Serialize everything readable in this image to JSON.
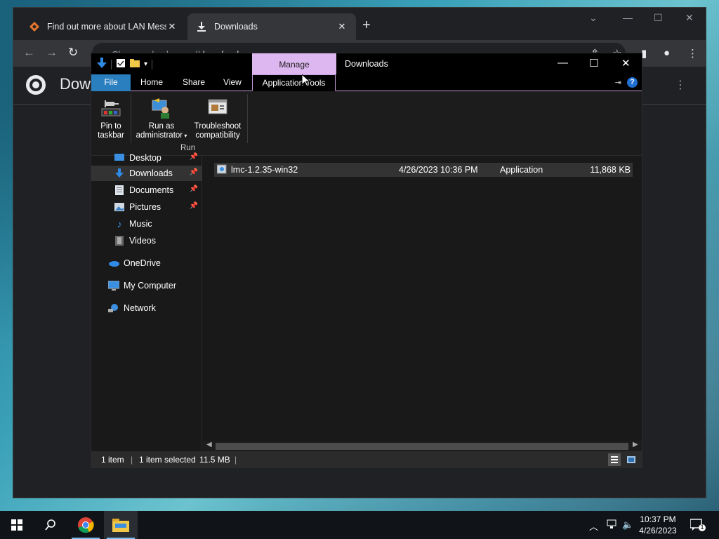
{
  "chrome": {
    "tabs": [
      {
        "label": "Find out more about LAN Messe",
        "icon": "lan-messenger-favicon"
      },
      {
        "label": "Downloads",
        "icon": "download-icon"
      }
    ],
    "address": {
      "prefix": "Chrome",
      "sep": "|",
      "url_scheme": "chrome://",
      "url_host": "downloads"
    },
    "page_title": "Dow"
  },
  "explorer": {
    "title": "Downloads",
    "contextual_tab_group": "Manage",
    "ribbon_tabs": {
      "file": "File",
      "home": "Home",
      "share": "Share",
      "view": "View",
      "app_tools": "Application Tools"
    },
    "ribbon_buttons": {
      "pin": {
        "line1": "Pin to",
        "line2": "taskbar"
      },
      "run_admin": {
        "line1": "Run as",
        "line2": "administrator"
      },
      "troubleshoot": {
        "line1": "Troubleshoot",
        "line2": "compatibility"
      }
    },
    "ribbon_group": "Run",
    "nav": [
      {
        "label": "Desktop",
        "pinned": true
      },
      {
        "label": "Downloads",
        "pinned": true,
        "selected": true
      },
      {
        "label": "Documents",
        "pinned": true
      },
      {
        "label": "Pictures",
        "pinned": true
      },
      {
        "label": "Music",
        "pinned": false
      },
      {
        "label": "Videos",
        "pinned": false
      },
      {
        "label": "OneDrive",
        "pinned": false
      },
      {
        "label": "My Computer",
        "pinned": false
      },
      {
        "label": "Network",
        "pinned": false
      }
    ],
    "files": [
      {
        "name": "lmc-1.2.35-win32",
        "date": "4/26/2023 10:36 PM",
        "type": "Application",
        "size": "11,868 KB"
      }
    ],
    "status": {
      "count": "1 item",
      "selected": "1 item selected",
      "size": "11.5 MB",
      "sep": "|"
    }
  },
  "taskbar": {
    "clock_time": "10:37 PM",
    "clock_date": "4/26/2023",
    "notification_count": "1"
  },
  "colors": {
    "manage_accent": "#ddb7f0",
    "file_tab": "#2a7fbf",
    "taskbar": "#101418"
  }
}
